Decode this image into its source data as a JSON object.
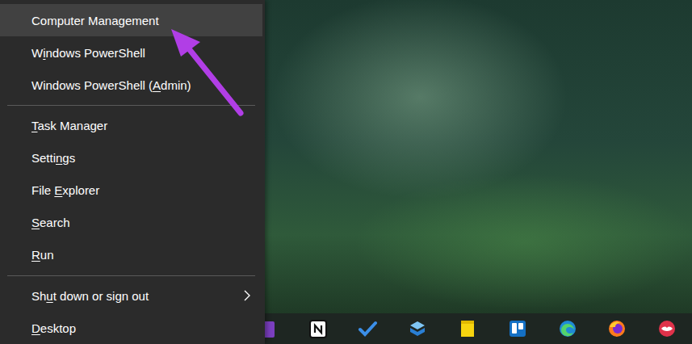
{
  "menu": {
    "items": [
      {
        "kind": "item",
        "label": "Computer Management",
        "underline": 13,
        "highlighted": true,
        "submenu": false
      },
      {
        "kind": "item",
        "label": "Windows PowerShell",
        "underline": 1,
        "highlighted": false,
        "submenu": false
      },
      {
        "kind": "item",
        "label": "Windows PowerShell (Admin)",
        "underline": 20,
        "highlighted": false,
        "submenu": false
      },
      {
        "kind": "separator"
      },
      {
        "kind": "item",
        "label": "Task Manager",
        "underline": 0,
        "highlighted": false,
        "submenu": false
      },
      {
        "kind": "item",
        "label": "Settings",
        "underline": 5,
        "highlighted": false,
        "submenu": false
      },
      {
        "kind": "item",
        "label": "File Explorer",
        "underline": 5,
        "highlighted": false,
        "submenu": false
      },
      {
        "kind": "item",
        "label": "Search",
        "underline": 0,
        "highlighted": false,
        "submenu": false
      },
      {
        "kind": "item",
        "label": "Run",
        "underline": 0,
        "highlighted": false,
        "submenu": false
      },
      {
        "kind": "separator"
      },
      {
        "kind": "item",
        "label": "Shut down or sign out",
        "underline": 2,
        "highlighted": false,
        "submenu": true
      },
      {
        "kind": "item",
        "label": "Desktop",
        "underline": 0,
        "highlighted": false,
        "submenu": false
      }
    ]
  },
  "annotation": {
    "kind": "arrow",
    "color": "#b13ee6"
  }
}
